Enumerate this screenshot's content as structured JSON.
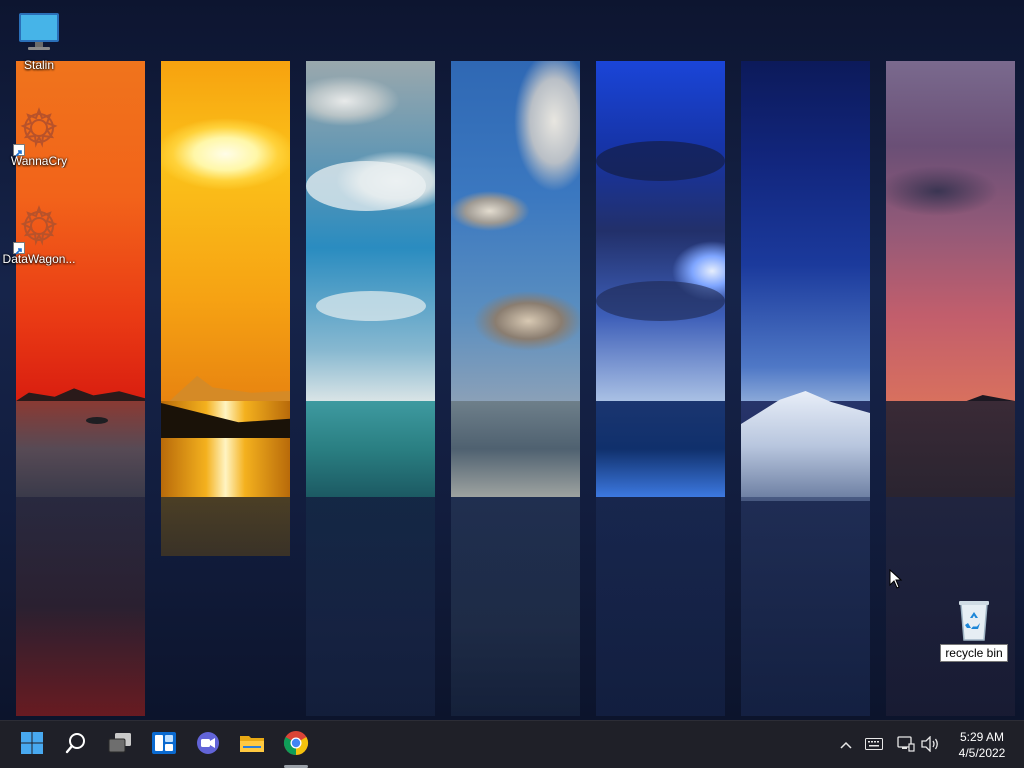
{
  "desktop": {
    "icons": [
      {
        "label": "Stalin",
        "icon": "monitor-icon"
      },
      {
        "label": "WannaCry",
        "icon": "gear-flower-icon",
        "shortcut": true
      },
      {
        "label": "DataWagon...",
        "icon": "gear-flower-icon",
        "shortcut": true
      },
      {
        "label": "recycle bin",
        "icon": "recycle-bin-icon"
      }
    ]
  },
  "taskbar": {
    "apps": [
      {
        "name": "Start",
        "icon": "windows-logo-icon"
      },
      {
        "name": "Search",
        "icon": "search-icon"
      },
      {
        "name": "Task View",
        "icon": "task-view-icon"
      },
      {
        "name": "Widgets",
        "icon": "widgets-icon"
      },
      {
        "name": "Chat",
        "icon": "teams-chat-icon"
      },
      {
        "name": "File Explorer",
        "icon": "folder-icon"
      },
      {
        "name": "Google Chrome",
        "icon": "chrome-icon"
      }
    ],
    "tray": {
      "icons": [
        "chevron-up-icon",
        "keyboard-icon",
        "network-icon",
        "volume-icon"
      ]
    },
    "clock": {
      "time": "5:29 AM",
      "date": "4/5/2022"
    }
  },
  "colors": {
    "taskbar_bg": "#1f2028",
    "accent_blue": "#0078d4"
  }
}
